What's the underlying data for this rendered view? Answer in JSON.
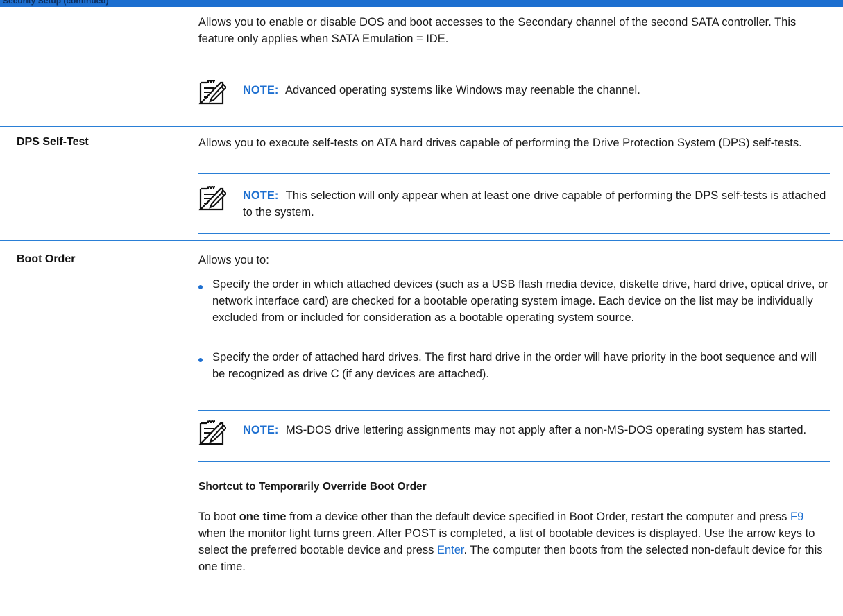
{
  "header": {
    "fragment": "Security Setup (continued)"
  },
  "rows": [
    {
      "label": "",
      "text": "Allows you to enable or disable DOS and boot accesses to the Secondary channel of the second SATA controller. This feature only applies when SATA Emulation = IDE.",
      "note": {
        "tag": "NOTE:",
        "text": "Advanced operating systems like Windows may reenable the channel."
      }
    },
    {
      "label": "DPS Self-Test",
      "text": "Allows you to execute self-tests on ATA hard drives capable of performing the Drive Protection System (DPS) self-tests.",
      "note": {
        "tag": "NOTE:",
        "text": "This selection will only appear when at least one drive capable of performing the DPS self-tests is attached to the system."
      }
    },
    {
      "label": "Boot Order",
      "intro": "Allows you to:",
      "bullets": [
        "Specify the order in which attached devices (such as a USB flash media device, diskette drive, hard drive, optical drive, or network interface card) are checked for a bootable operating system image. Each device on the list may be individually excluded from or included for consideration as a bootable operating system source.",
        "Specify the order of attached hard drives. The first hard drive in the order will have priority in the boot sequence and will be recognized as drive C (if any devices are attached)."
      ],
      "note": {
        "tag": "NOTE:",
        "text": "MS-DOS drive lettering assignments may not apply after a non-MS-DOS operating system has started."
      },
      "subheading": "Shortcut to Temporarily Override Boot Order",
      "para": {
        "p1": "To boot ",
        "bold": "one time",
        "p2": " from a device other than the default device specified in Boot Order, restart the computer and press ",
        "key1": "F9",
        "p3": " when the monitor light turns green. After POST is completed, a list of bootable devices is displayed. Use the arrow keys to select the preferred bootable device and press ",
        "key2": "Enter",
        "p4": ". The computer then boots from the selected non-default device for this one time."
      }
    }
  ],
  "colors": {
    "accent": "#1d6fd0"
  }
}
